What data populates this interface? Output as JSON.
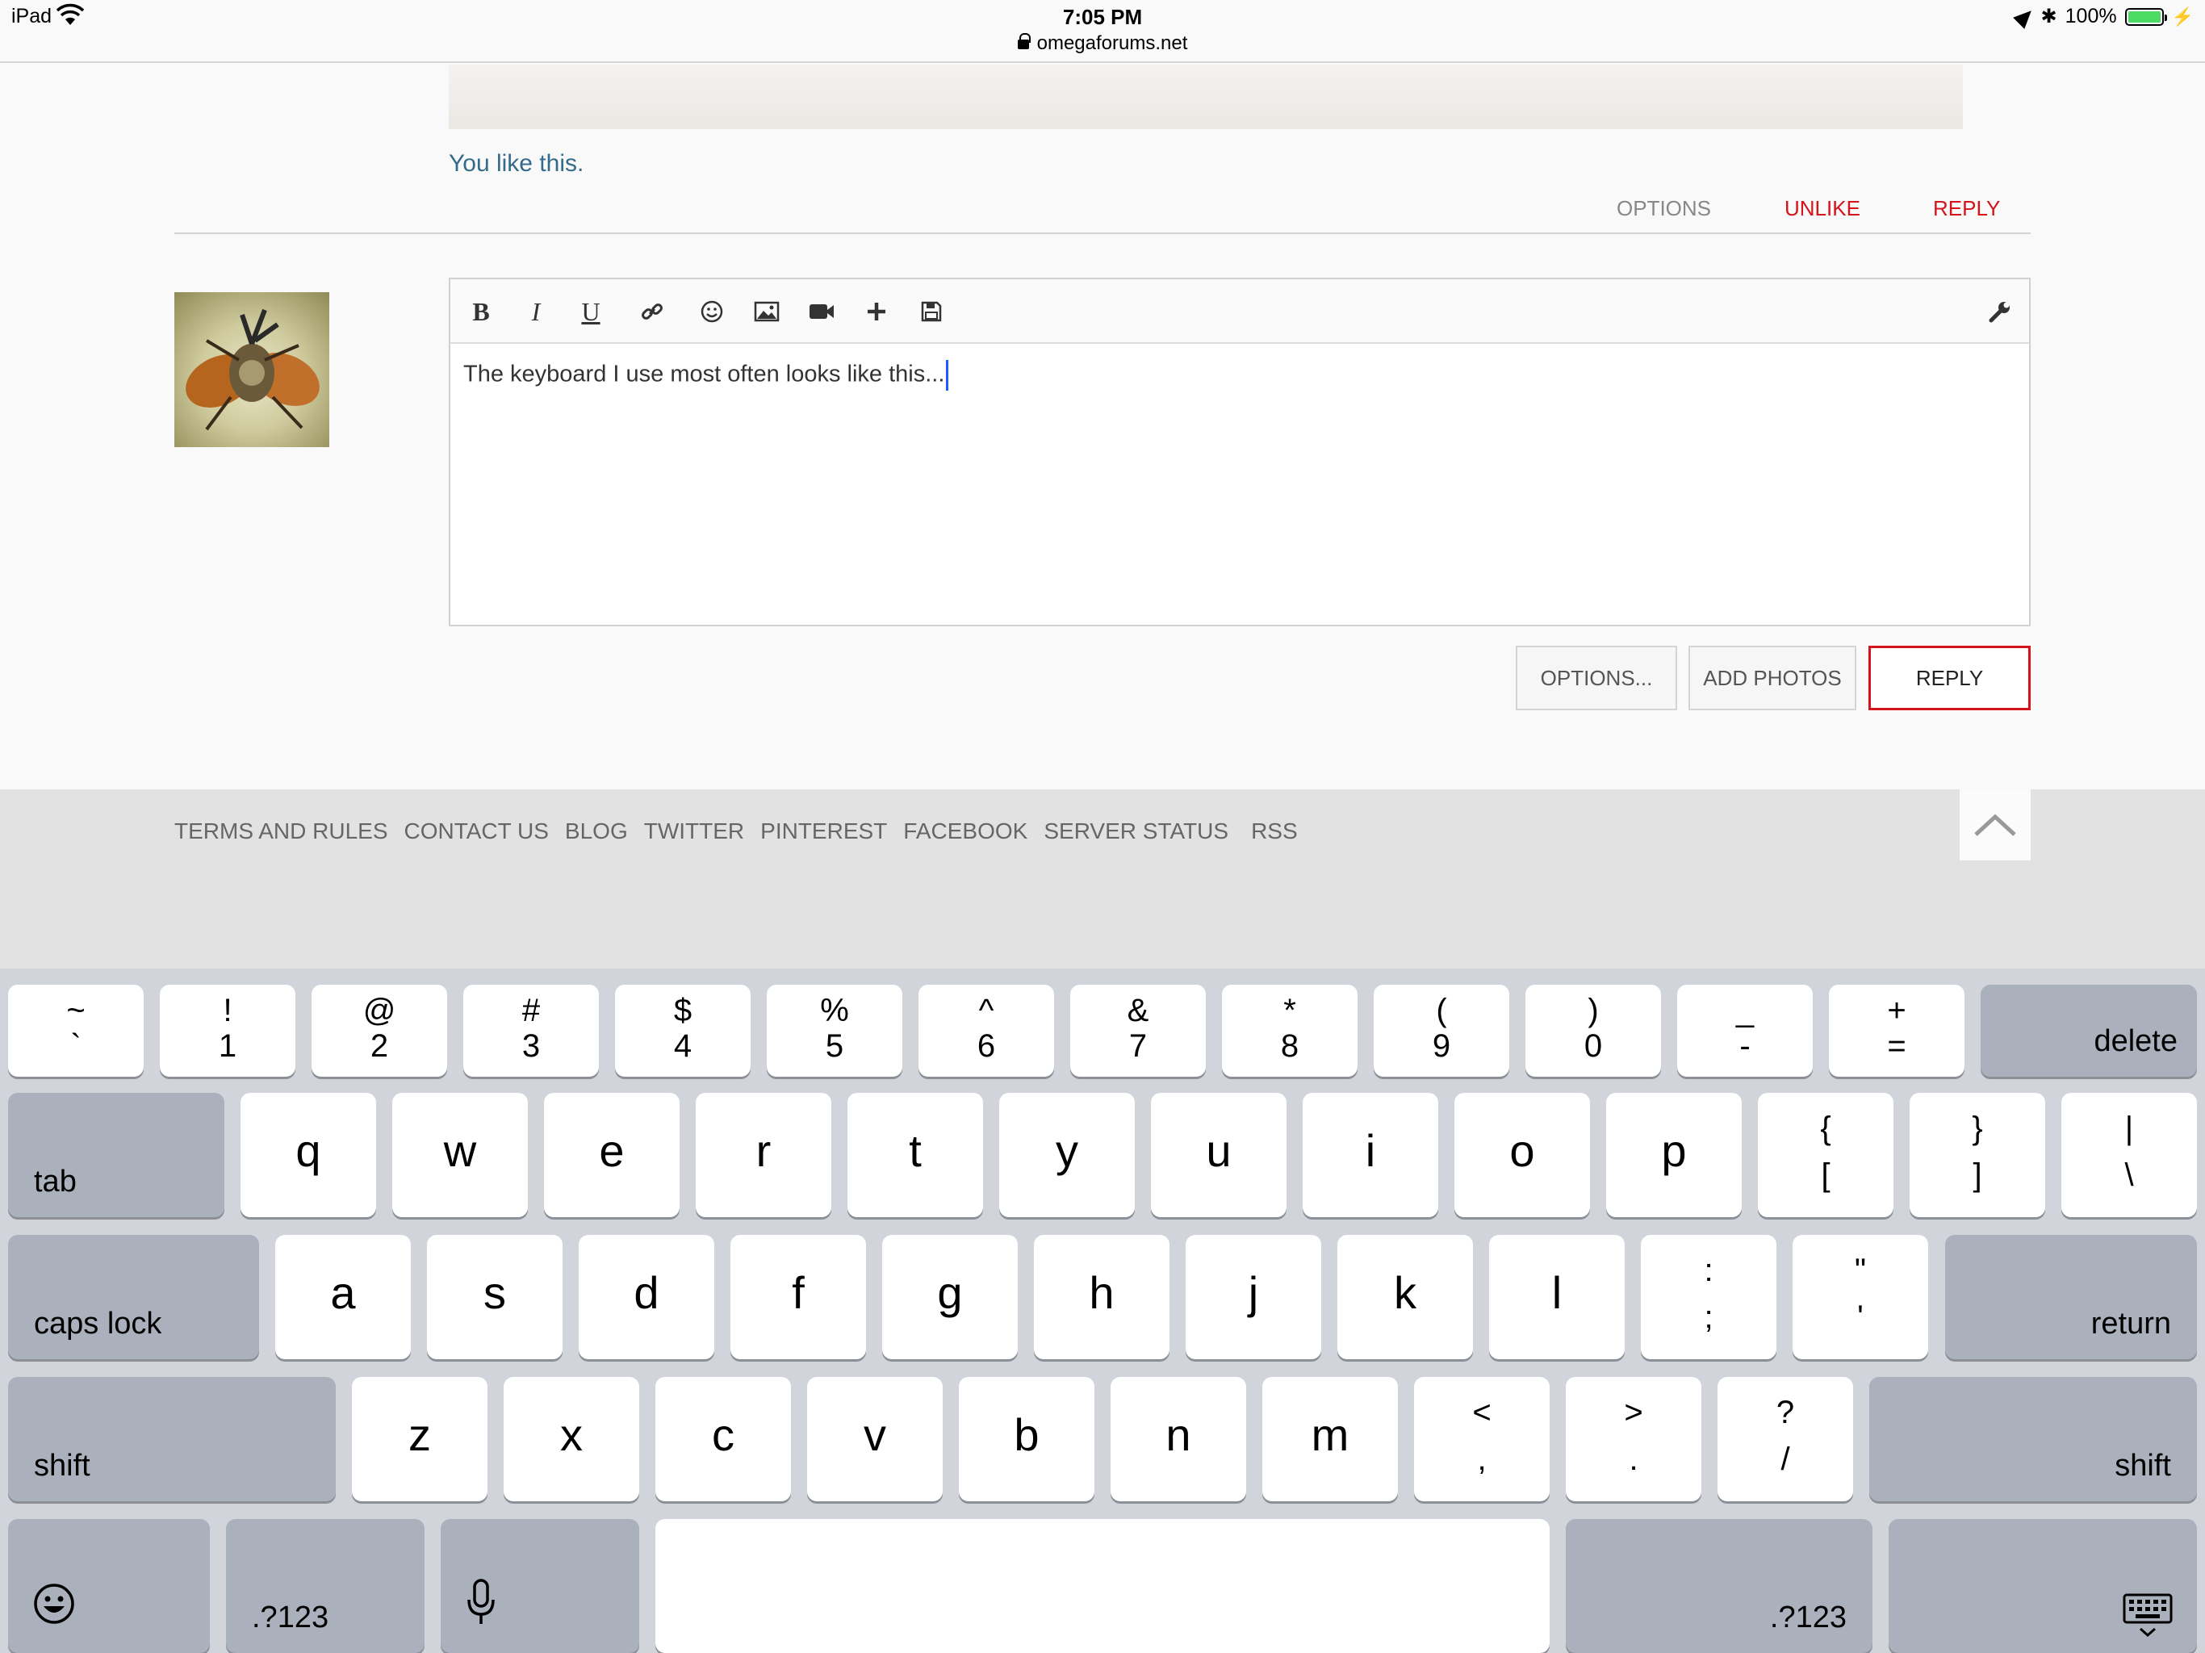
{
  "status_bar": {
    "device": "iPad",
    "time": "7:05 PM",
    "url": "omegaforums.net",
    "battery": "100%"
  },
  "post": {
    "likes_text": "You like this.",
    "actions": {
      "options": "OPTIONS",
      "unlike": "UNLIKE",
      "reply": "REPLY"
    }
  },
  "editor": {
    "text": "The keyboard I use most often looks like this...",
    "toolbar": [
      "bold-icon",
      "italic-icon",
      "underline-icon",
      "link-icon",
      "smiley-icon",
      "image-icon",
      "video-icon",
      "plus-icon",
      "save-icon",
      "wrench-icon"
    ],
    "toolbar_glyphs": {
      "bold": "B",
      "italic": "I",
      "underline": "U"
    }
  },
  "buttons": {
    "options": "OPTIONS...",
    "add_photos": "ADD PHOTOS",
    "reply": "REPLY"
  },
  "footer": {
    "links": [
      "TERMS AND RULES",
      "CONTACT US",
      "BLOG",
      "TWITTER",
      "PINTEREST",
      "FACEBOOK",
      "SERVER STATUS",
      "RSS"
    ]
  },
  "keyboard": {
    "number_row": [
      {
        "top": "~",
        "bottom": "`"
      },
      {
        "top": "!",
        "bottom": "1"
      },
      {
        "top": "@",
        "bottom": "2"
      },
      {
        "top": "#",
        "bottom": "3"
      },
      {
        "top": "$",
        "bottom": "4"
      },
      {
        "top": "%",
        "bottom": "5"
      },
      {
        "top": "^",
        "bottom": "6"
      },
      {
        "top": "&",
        "bottom": "7"
      },
      {
        "top": "*",
        "bottom": "8"
      },
      {
        "top": "(",
        "bottom": "9"
      },
      {
        "top": ")",
        "bottom": "0"
      },
      {
        "top": "_",
        "bottom": "-"
      },
      {
        "top": "+",
        "bottom": "="
      }
    ],
    "row_q": [
      "q",
      "w",
      "e",
      "r",
      "t",
      "y",
      "u",
      "i",
      "o",
      "p"
    ],
    "row_q_punct": [
      {
        "top": "{",
        "bottom": "["
      },
      {
        "top": "}",
        "bottom": "]"
      },
      {
        "top": "|",
        "bottom": "\\"
      }
    ],
    "row_a": [
      "a",
      "s",
      "d",
      "f",
      "g",
      "h",
      "j",
      "k",
      "l"
    ],
    "row_a_punct": [
      {
        "top": ":",
        "bottom": ";"
      },
      {
        "top": "\"",
        "bottom": "'"
      }
    ],
    "row_z": [
      "z",
      "x",
      "c",
      "v",
      "b",
      "n",
      "m"
    ],
    "row_z_punct": [
      {
        "top": "<",
        "bottom": ","
      },
      {
        "top": ">",
        "bottom": "."
      },
      {
        "top": "?",
        "bottom": "/"
      }
    ],
    "labels": {
      "delete": "delete",
      "tab": "tab",
      "caps_lock": "caps lock",
      "return": "return",
      "shift_left": "shift",
      "shift_right": "shift",
      "numbers_left": ".?123",
      "numbers_right": ".?123"
    }
  }
}
